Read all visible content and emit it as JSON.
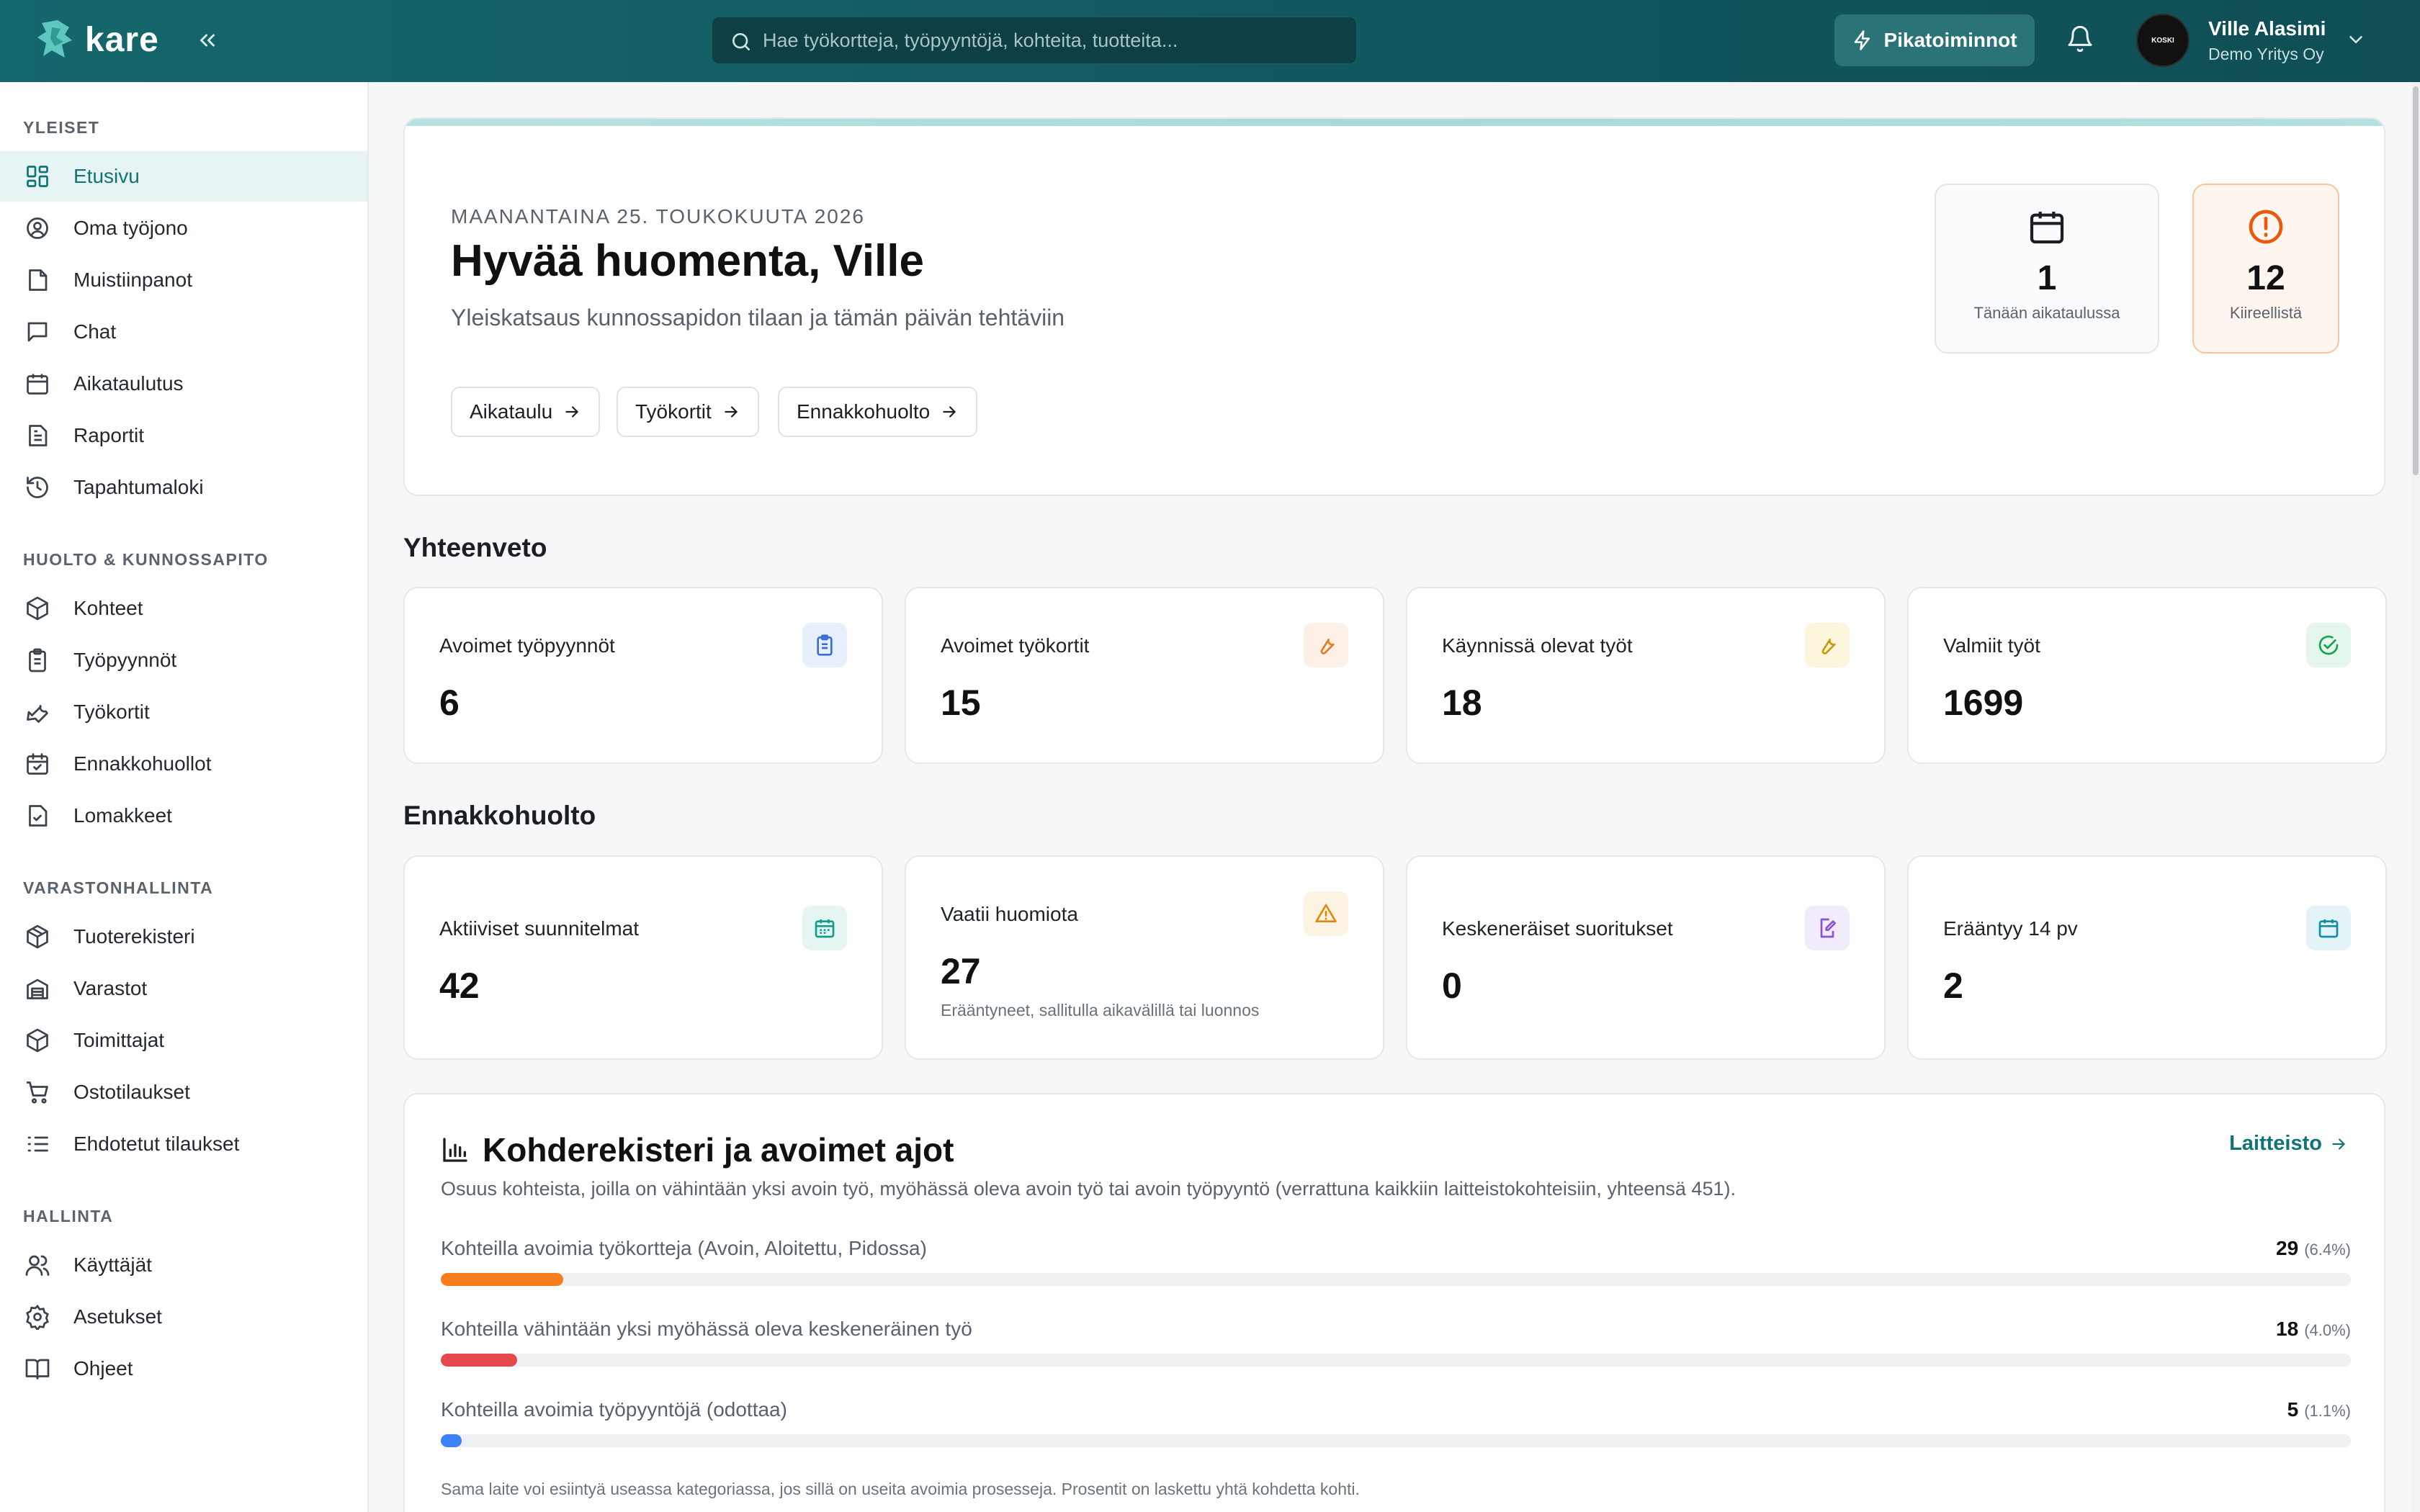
{
  "topbar": {
    "logo_text": "kare",
    "search_placeholder": "Hae työkortteja, työpyyntöjä, kohteita, tuotteita...",
    "quick_actions": "Pikatoiminnot",
    "user_name": "Ville Alasimi",
    "user_org": "Demo Yritys Oy",
    "avatar_text": "KOSKI"
  },
  "sidebar": {
    "sections": [
      {
        "title": "YLEISET"
      },
      {
        "title": "HUOLTO & KUNNOSSAPITO"
      },
      {
        "title": "VARASTONHALLINTA"
      },
      {
        "title": "HALLINTA"
      }
    ],
    "items": [
      {
        "label": "Etusivu",
        "icon": "dashboard-icon"
      },
      {
        "label": "Oma työjono",
        "icon": "user-circle-icon"
      },
      {
        "label": "Muistiinpanot",
        "icon": "note-icon"
      },
      {
        "label": "Chat",
        "icon": "chat-icon"
      },
      {
        "label": "Aikataulutus",
        "icon": "calendar-icon"
      },
      {
        "label": "Raportit",
        "icon": "report-icon"
      },
      {
        "label": "Tapahtumaloki",
        "icon": "history-icon"
      },
      {
        "label": "Kohteet",
        "icon": "box-icon"
      },
      {
        "label": "Työpyynnöt",
        "icon": "clipboard-icon"
      },
      {
        "label": "Työkortit",
        "icon": "wrench-icon"
      },
      {
        "label": "Ennakkohuollot",
        "icon": "calendar-check-icon"
      },
      {
        "label": "Lomakkeet",
        "icon": "file-check-icon"
      },
      {
        "label": "Tuoterekisteri",
        "icon": "package-icon"
      },
      {
        "label": "Varastot",
        "icon": "warehouse-icon"
      },
      {
        "label": "Toimittajat",
        "icon": "truck-box-icon"
      },
      {
        "label": "Ostotilaukset",
        "icon": "cart-icon"
      },
      {
        "label": "Ehdotetut tilaukset",
        "icon": "list-icon"
      },
      {
        "label": "Käyttäjät",
        "icon": "users-icon"
      },
      {
        "label": "Asetukset",
        "icon": "gear-icon"
      },
      {
        "label": "Ohjeet",
        "icon": "book-icon"
      }
    ]
  },
  "hero": {
    "date": "MAANANTAINA 25. TOUKOKUUTA 2026",
    "greeting": "Hyvää huomenta, Ville",
    "subtitle": "Yleiskatsaus kunnossapidon tilaan ja tämän päivän tehtäviin",
    "buttons": [
      "Aikataulu",
      "Työkortit",
      "Ennakkohuolto"
    ],
    "today": {
      "value": "1",
      "label": "Tänään aikataulussa"
    },
    "urgent": {
      "value": "12",
      "label": "Kiireellistä"
    }
  },
  "summary": {
    "title": "Yhteenveto",
    "cards": [
      {
        "label": "Avoimet työpyynnöt",
        "value": "6"
      },
      {
        "label": "Avoimet työkortit",
        "value": "15"
      },
      {
        "label": "Käynnissä olevat työt",
        "value": "18"
      },
      {
        "label": "Valmiit työt",
        "value": "1699"
      }
    ]
  },
  "preventive": {
    "title": "Ennakkohuolto",
    "cards": [
      {
        "label": "Aktiiviset suunnitelmat",
        "value": "42",
        "note": ""
      },
      {
        "label": "Vaatii huomiota",
        "value": "27",
        "note": "Erääntyneet, sallitulla aikavälillä tai luonnos"
      },
      {
        "label": "Keskeneräiset suoritukset",
        "value": "0",
        "note": ""
      },
      {
        "label": "Erääntyy 14 pv",
        "value": "2",
        "note": ""
      }
    ]
  },
  "registry": {
    "title": "Kohderekisteri ja avoimet ajot",
    "link": "Laitteisto",
    "description": "Osuus kohteista, joilla on vähintään yksi avoin työ, myöhässä oleva avoin työ tai avoin työpyyntö (verrattuna kaikkiin laitteistokohteisiin, yhteensä 451).",
    "bars": [
      {
        "label": "Kohteilla avoimia työkortteja (Avoin, Aloitettu, Pidossa)",
        "count": "29",
        "pct": "(6.4%)",
        "fraction": 0.064,
        "color": "#f97f1e"
      },
      {
        "label": "Kohteilla vähintään yksi myöhässä oleva keskeneräinen työ",
        "count": "18",
        "pct": "(4.0%)",
        "fraction": 0.04,
        "color": "#e5484d"
      },
      {
        "label": "Kohteilla avoimia työpyyntöjä (odottaa)",
        "count": "5",
        "pct": "(1.1%)",
        "fraction": 0.011,
        "color": "#3b82f6"
      }
    ],
    "footnote": "Sama laite voi esiintyä useassa kategoriassa, jos sillä on useita avoimia prosesseja. Prosentit on laskettu yhtä kohdetta kohti."
  }
}
